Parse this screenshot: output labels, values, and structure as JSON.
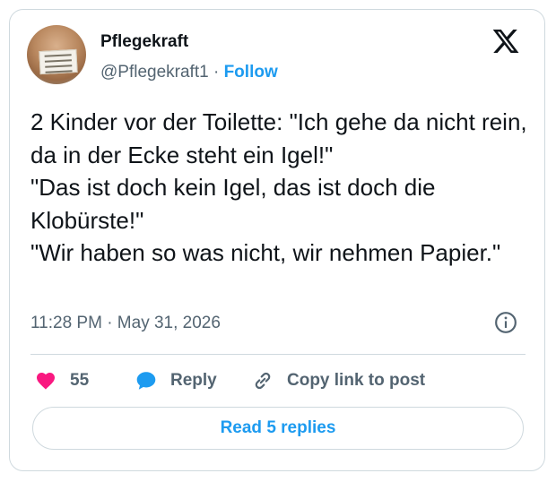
{
  "author": {
    "name": "Pflegekraft",
    "handle": "@Pflegekraft1",
    "separator": "·",
    "follow_label": "Follow",
    "avatar_icon": "avatar-crocheted-figure-with-sign"
  },
  "tweet": {
    "text": "2 Kinder vor der Toilette: \"Ich gehe da nicht rein, da in der Ecke steht ein Igel!\"\n\"Das ist doch kein Igel, das ist doch die Klobürste!\"\n\"Wir haben so was nicht, wir nehmen Papier.\"",
    "timestamp": "11:28 PM · May 31, 2026"
  },
  "actions": {
    "like_count": "55",
    "reply_label": "Reply",
    "copy_label": "Copy link to post"
  },
  "footer": {
    "read_replies_label": "Read 5 replies"
  },
  "colors": {
    "accent": "#1d9bf0",
    "like": "#f91880",
    "muted": "#536471",
    "border": "#cfd9de"
  }
}
